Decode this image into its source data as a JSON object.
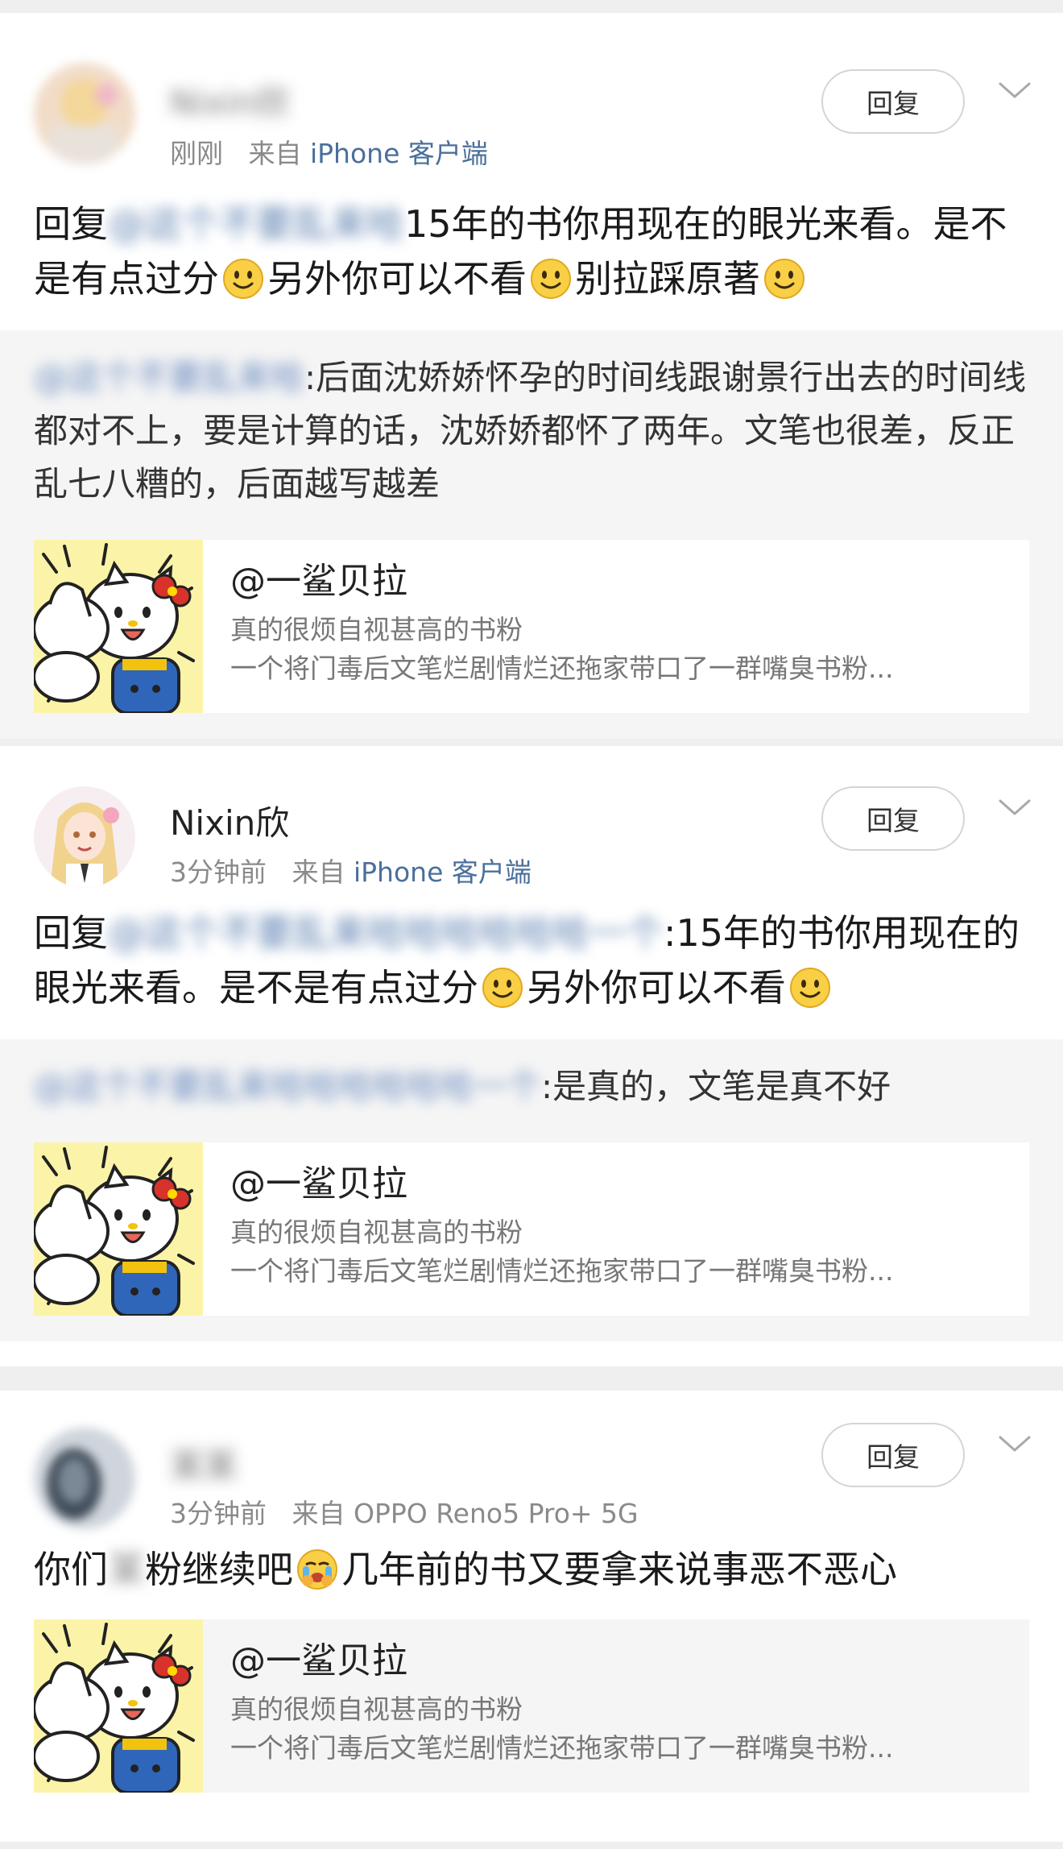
{
  "comments": [
    {
      "username": "Nixin欣",
      "time": "刚刚",
      "from_label": "来自",
      "source": "iPhone 客户端",
      "reply_label": "回复",
      "comment_prefix": "回复",
      "comment_mention": "@这个不要乱来哈",
      "comment_text_1": "15年的书你用现在的眼光来看。是不是有点过分",
      "comment_text_2": "另外你可以不看",
      "comment_text_3": "别拉踩原著",
      "quote_mention": "@这个不要乱来哈",
      "quote_text": ":后面沈娇娇怀孕的时间线跟谢景行出去的时间线都对不上，要是计算的话，沈娇娇都怀了两年。文笔也很差，反正乱七八糟的，后面越写越差",
      "link_title": "@一鲨贝拉",
      "link_subtitle": "真的很烦自视甚高的书粉",
      "link_desc": "一个将门毒后文笔烂剧情烂还拖家带口了一群嘴臭书粉..."
    },
    {
      "username": "Nixin欣",
      "time": "3分钟前",
      "from_label": "来自",
      "source": "iPhone 客户端",
      "reply_label": "回复",
      "comment_prefix": "回复",
      "comment_mention": "@这个不要乱来哈哈哈哈哈哈一个",
      "comment_text_1": ":15年的书你用现在的眼光来看。是不是有点过分",
      "comment_text_2": "另外你可以不看",
      "quote_mention": "@这个不要乱来哈哈哈哈哈哈一个",
      "quote_text": ":是真的，文笔是真不好",
      "link_title": "@一鲨贝拉",
      "link_subtitle": "真的很烦自视甚高的书粉",
      "link_desc": "一个将门毒后文笔烂剧情烂还拖家带口了一群嘴臭书粉..."
    },
    {
      "username": "某某",
      "time": "3分钟前",
      "from_label": "来自",
      "source": "OPPO Reno5 Pro+ 5G",
      "reply_label": "回复",
      "comment_text_a": "你们",
      "comment_hidden": "某",
      "comment_text_b": "粉继续吧",
      "comment_text_c": "几年前的书又要拿来说事恶不恶心",
      "link_title": "@一鲨贝拉",
      "link_subtitle": "真的很烦自视甚高的书粉",
      "link_desc": "一个将门毒后文笔烂剧情烂还拖家带口了一群嘴臭书粉..."
    }
  ],
  "colors": {
    "link_blue": "#4a6f9a",
    "meta_grey": "#8a8a8a",
    "divider": "#efefef",
    "quote_bg": "#f5f5f5"
  },
  "icons": [
    "smile-emoji-icon",
    "crying-emoji-icon",
    "chevron-down-icon",
    "avatar-image",
    "hello-kitty-thumbnail"
  ]
}
